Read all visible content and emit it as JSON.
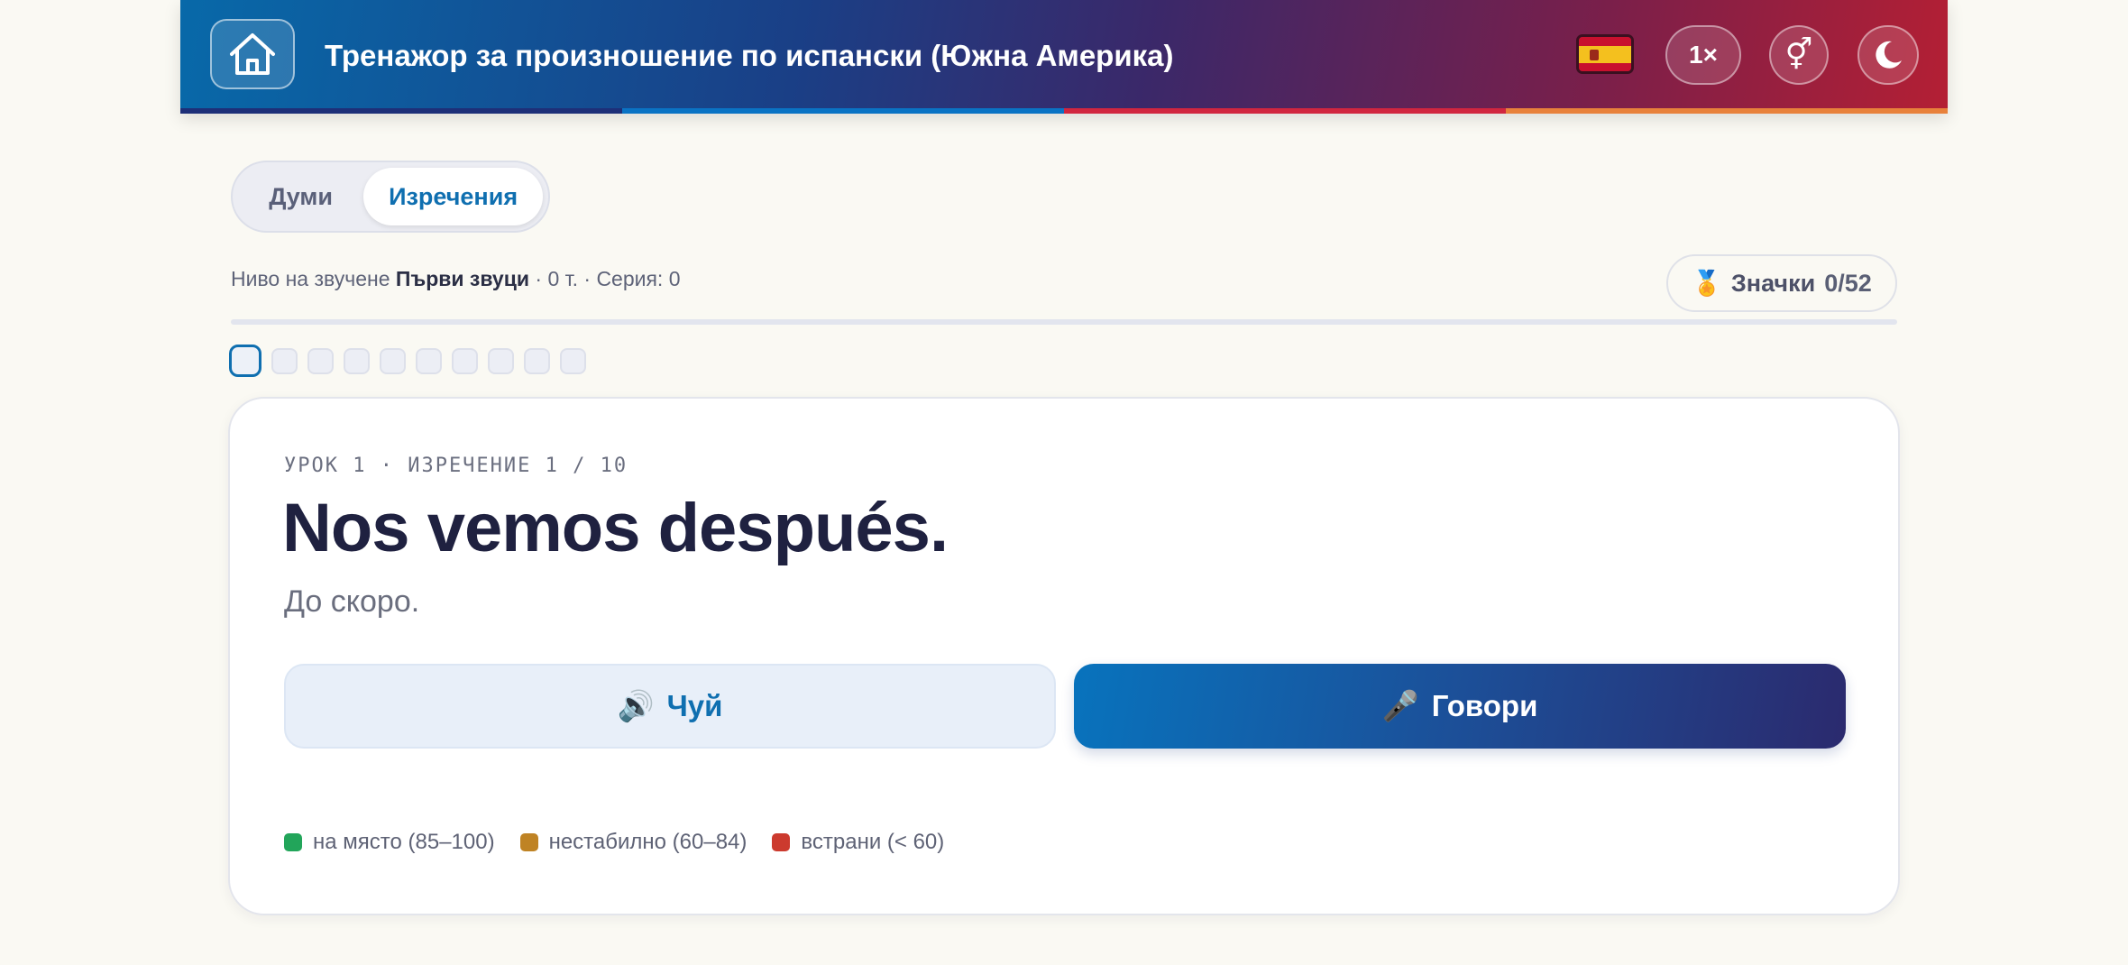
{
  "header": {
    "title": "Тренажор за произношение по испански (Южна Америка)",
    "home_icon": "home-icon",
    "flag_icon": "spain-flag-icon",
    "speed_label": "1×",
    "gender_icon": "⚥",
    "theme_icon": "moon-icon",
    "stripe_colors": [
      "#1e2f78",
      "#0a73c4",
      "#d1263f",
      "#e8813b"
    ]
  },
  "mode_toggle": {
    "words_label": "Думи",
    "phrases_label": "Изречения",
    "active": "Изречения"
  },
  "status": {
    "level_prefix": "Ниво на звучене",
    "level_name": "Първи звуци",
    "points": "· 0 т.",
    "streak": "· Серия: 0"
  },
  "badges": {
    "icon": "🏅",
    "label": "Значки",
    "count": "0/52"
  },
  "progress": {
    "fraction": 0,
    "total_items": 10,
    "current_index": 0
  },
  "card": {
    "lesson_label": "УРОК 1 · ИЗРЕЧЕНИЕ 1 / 10",
    "phrase": "Nos vemos después.",
    "translation": "До скоро.",
    "listen_icon": "🔊",
    "listen_label": "Чуй",
    "speak_icon": "🎤",
    "speak_label": "Говори"
  },
  "legend": [
    {
      "label": "на място (85–100)",
      "color": "#22a55a"
    },
    {
      "label": "нестабилно (60–84)",
      "color": "#bf8324"
    },
    {
      "label": "встрани (< 60)",
      "color": "#cc3a2e"
    }
  ],
  "colors": {
    "accent": "#0f6fb0",
    "page_background": "#faf9f3"
  }
}
